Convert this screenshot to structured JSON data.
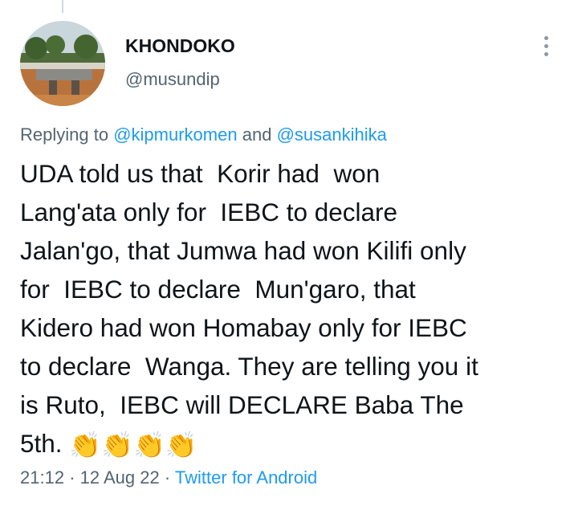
{
  "tweet": {
    "display_name": "KHONDOKO",
    "handle": "@musundip",
    "replying_prefix": "Replying to",
    "reply_to_1": "@kipmurkomen",
    "reply_and": "and",
    "reply_to_2": "@susankihika",
    "text": "UDA told us that  Korir had  won\nLang'ata only for  IEBC to declare\nJalan'go, that Jumwa had won Kilifi only\nfor  IEBC to declare  Mun'garo, that\nKidero had won Homabay only for IEBC\nto declare  Wanga. They are telling you it\nis Ruto,  IEBC will DECLARE Baba The\n5th. ",
    "emoji": [
      "👏",
      "👏",
      "👏",
      "👏"
    ],
    "time": "21:12",
    "separator": "·",
    "date": "12 Aug 22",
    "source": "Twitter for Android"
  },
  "colors": {
    "link": "#1d9bf0",
    "secondary_text": "#536471",
    "primary_text": "#0f1419",
    "thread_line": "#cfd9de"
  },
  "icons": {
    "more": "more-options-icon",
    "avatar": "avatar-photo"
  }
}
